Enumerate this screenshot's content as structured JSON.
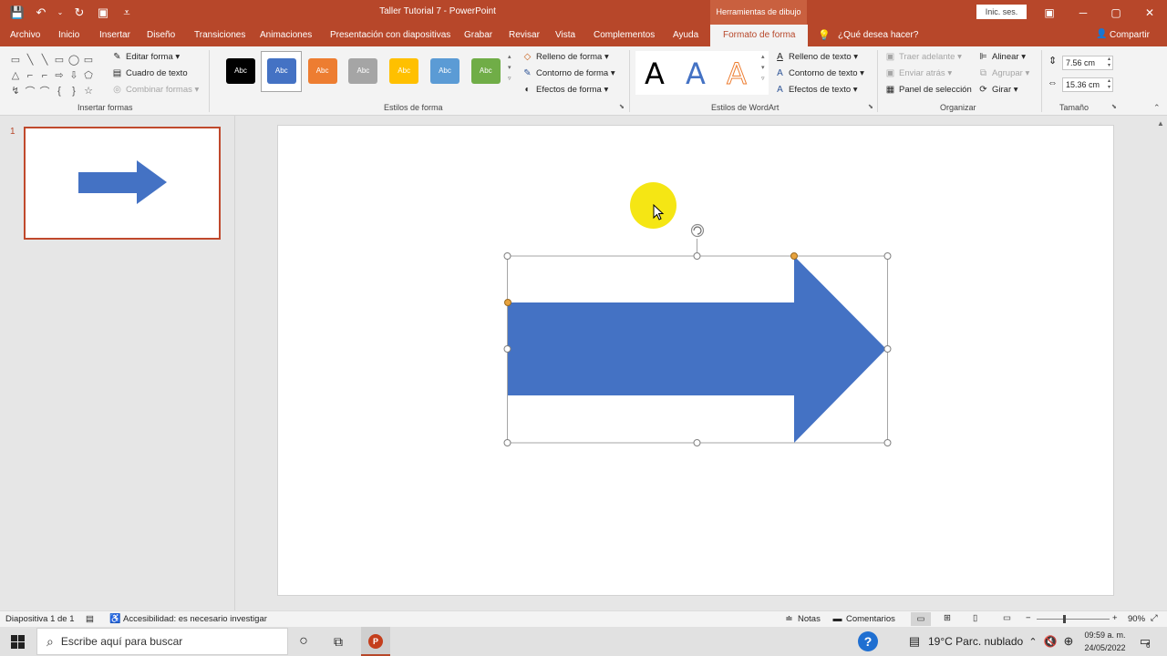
{
  "title_bar": {
    "doc_title": "Taller Tutorial 7  -  PowerPoint",
    "context_tools": "Herramientas de dibujo",
    "signin": "Inic. ses.",
    "qat": {
      "save": "💾",
      "undo": "↶",
      "undo_more": "⌄",
      "redo": "↻",
      "present": "▣",
      "customize": "⩡"
    },
    "controls": {
      "ribbon_options": "▣",
      "minimize": "─",
      "maximize": "▢",
      "close": "✕"
    }
  },
  "menu": {
    "tabs": [
      "Archivo",
      "Inicio",
      "Insertar",
      "Diseño",
      "Transiciones",
      "Animaciones",
      "Presentación con diapositivas",
      "Grabar",
      "Revisar",
      "Vista",
      "Complementos",
      "Ayuda",
      "Formato de forma"
    ],
    "active_tab": "Formato de forma",
    "tell_me": "¿Qué desea hacer?",
    "share": "Compartir",
    "tell_me_icon": "💡",
    "share_icon": "👤"
  },
  "ribbon": {
    "insert_shapes": {
      "label": "Insertar formas",
      "edit_shape": "Editar forma",
      "text_box": "Cuadro de texto",
      "merge_shapes": "Combinar formas",
      "gallery_glyphs": [
        "▭",
        "╲",
        "╲",
        "▭",
        "◯",
        "▭",
        "△",
        "⌐",
        "⌐",
        "⇨",
        "⇩",
        "⬠",
        "↯",
        "⌒",
        "⌒",
        "{",
        "}",
        "☆"
      ]
    },
    "shape_styles": {
      "label": "Estilos de forma",
      "swatch_text": "Abc",
      "swatches": [
        "#000000",
        "#4472c4",
        "#ed7d31",
        "#a5a5a5",
        "#ffc000",
        "#5b9bd5",
        "#70ad47"
      ],
      "fill": "Relleno de forma",
      "outline": "Contorno de forma",
      "effects": "Efectos de forma"
    },
    "wordart": {
      "label": "Estilos de WordArt",
      "letter": "A",
      "text_fill": "Relleno de texto",
      "text_outline": "Contorno de texto",
      "text_effects": "Efectos de texto"
    },
    "arrange": {
      "label": "Organizar",
      "bring_forward": "Traer adelante",
      "send_backward": "Enviar atrás",
      "selection_pane": "Panel de selección",
      "align": "Alinear",
      "group": "Agrupar",
      "rotate": "Girar"
    },
    "size": {
      "label": "Tamaño",
      "height": "7.56 cm",
      "width": "15.36 cm"
    }
  },
  "thumbnails": {
    "slide_number": "1"
  },
  "status": {
    "slide_info": "Diapositiva 1 de 1",
    "accessibility": "Accesibilidad: es necesario investigar",
    "notes": "Notas",
    "comments": "Comentarios",
    "zoom": "90%",
    "zoom_level": 0.9,
    "zoom_minus": "−",
    "zoom_plus": "+"
  },
  "taskbar": {
    "search_placeholder": "Escribe aquí para buscar",
    "weather": "19°C  Parc. nublado",
    "time": "09:59 a. m.",
    "date": "24/05/2022",
    "notif_count": "6"
  },
  "colors": {
    "accent": "#b7472a",
    "shape_fill": "#4472c4",
    "cursor_highlight": "#f4e400"
  }
}
